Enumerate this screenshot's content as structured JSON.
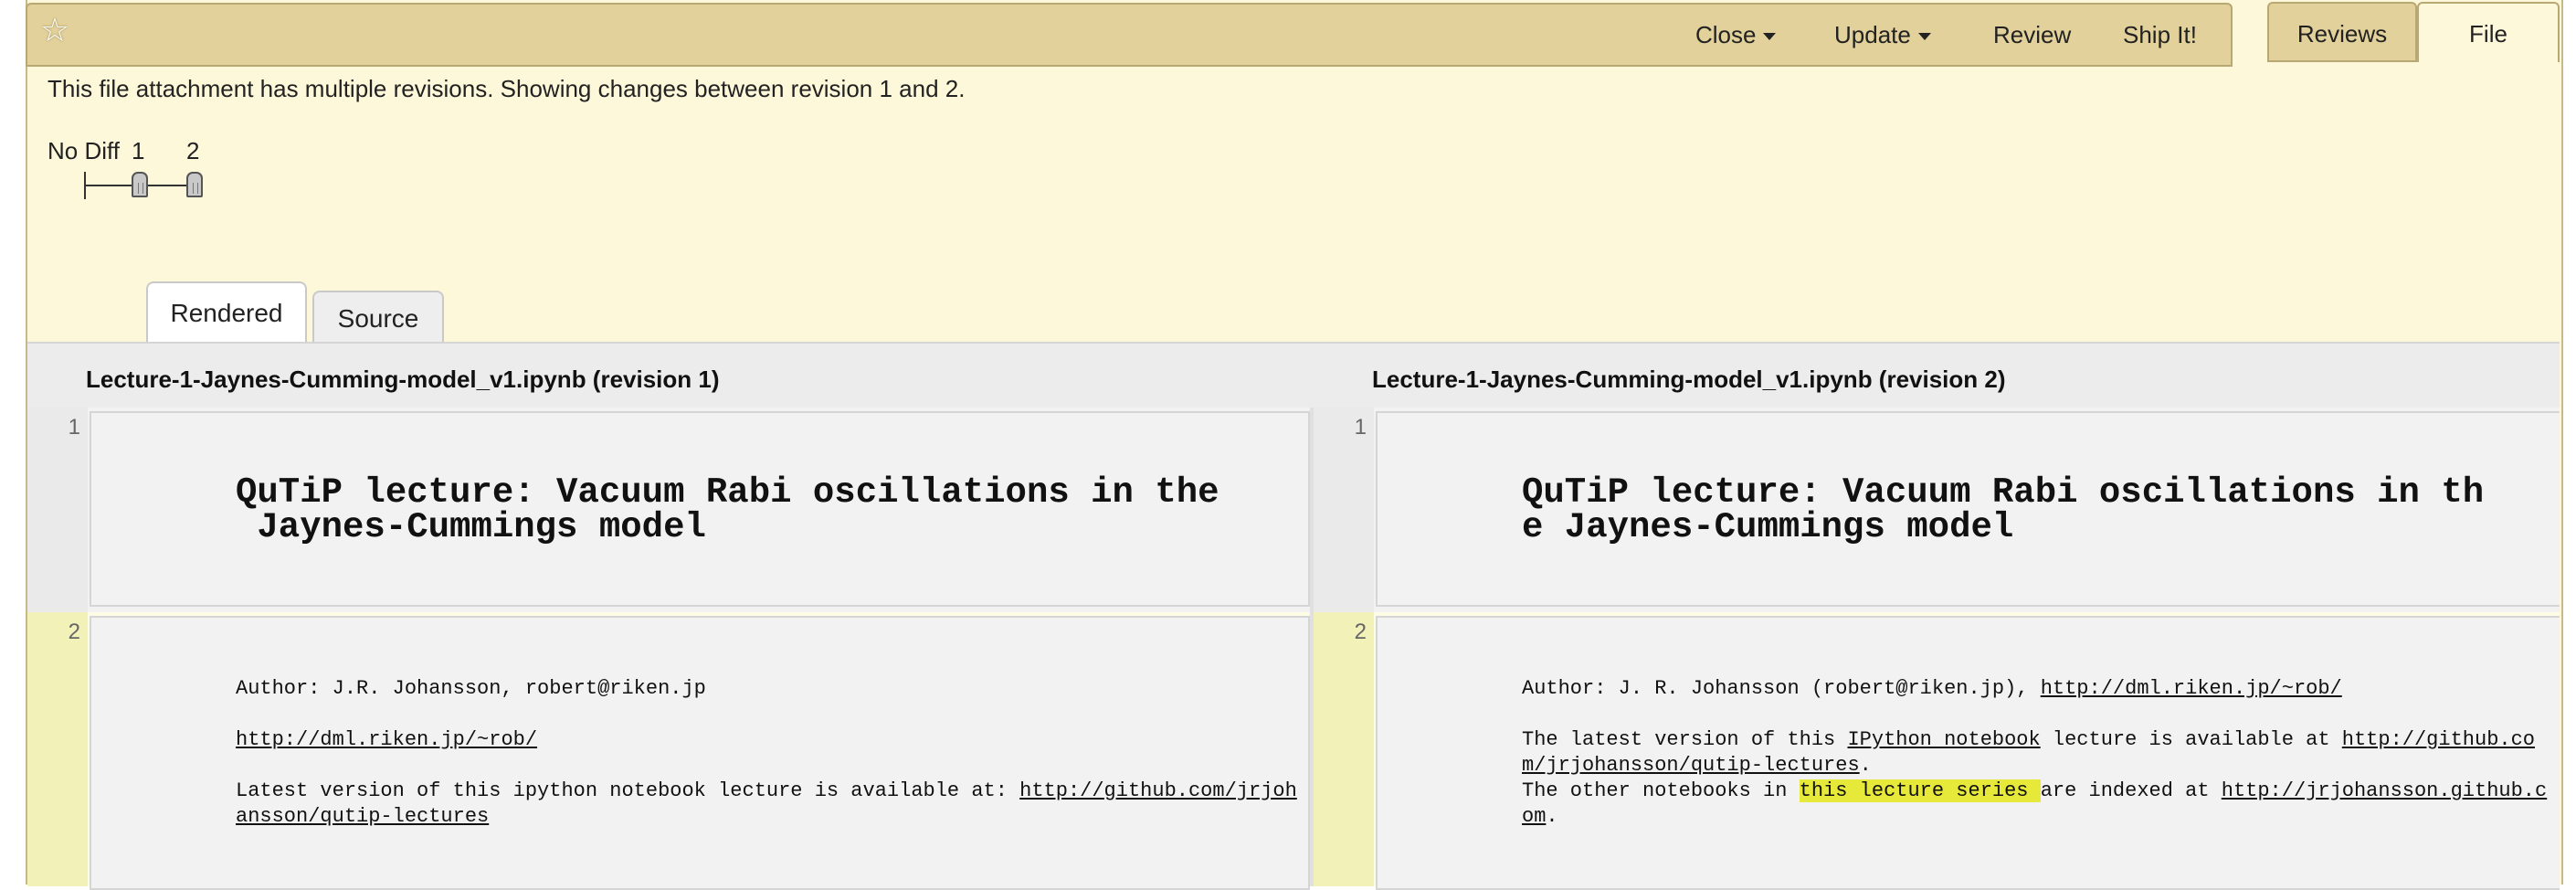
{
  "toolbar": {
    "menu": [
      {
        "label": "Close",
        "has_caret": true
      },
      {
        "label": "Update",
        "has_caret": true
      },
      {
        "label": "Review",
        "has_caret": false
      },
      {
        "label": "Ship It!",
        "has_caret": false
      }
    ],
    "tabs": {
      "reviews": "Reviews",
      "file": "File"
    }
  },
  "notice": "This file attachment has multiple revisions. Showing changes between revision 1 and 2.",
  "revision_selector": {
    "no_diff": "No Diff",
    "rev1": "1",
    "rev2": "2"
  },
  "view_tabs": {
    "rendered": "Rendered",
    "source": "Source"
  },
  "diff": {
    "left_file": "Lecture-1-Jaynes-Cumming-model_v1.ipynb (revision 1)",
    "right_file": "Lecture-1-Jaynes-Cumming-model_v1.ipynb (revision 2)",
    "rows": [
      {
        "line_left": "1",
        "line_right": "1",
        "left_title_l1": "QuTiP lecture: Vacuum Rabi oscillations in the",
        "left_title_l2": " Jaynes-Cummings model",
        "right_title_l1": "QuTiP lecture: Vacuum Rabi oscillations in th",
        "right_title_l2": "e Jaynes-Cummings model"
      },
      {
        "line_left": "2",
        "line_right": "2",
        "left": {
          "author": "Author: J.R. Johansson, robert@riken.jp",
          "url": "http://dml.riken.jp/~rob/",
          "latest_prefix": "Latest version of this ipython notebook lecture is available at: ",
          "latest_link_l1": "http://github.com/jrjoh",
          "latest_link_l2": "ansson/qutip-lectures"
        },
        "right": {
          "author_prefix": "Author: J. R. Johansson (robert@riken.jp), ",
          "author_link": "http://dml.riken.jp/~rob/",
          "latest_prefix": "The latest version of this ",
          "ipython_link": "IPython notebook",
          "latest_mid": " lecture is available at ",
          "github_link_l1": "http://github.co",
          "github_link_l2": "m/jrjohansson/qutip-lectures",
          "period1": ".",
          "other_prefix": "The other notebooks in ",
          "other_highlight": "this lecture series ",
          "other_mid": "are indexed at ",
          "index_link_l1": "http://jrjohansson.github.c",
          "index_link_l2": "om",
          "period2": "."
        }
      }
    ]
  },
  "colors": {
    "toolbar_bg": "#e2d19a",
    "page_bg": "#fef8da",
    "changed_gutter": "#f2f2b8",
    "highlight": "#e6e83a"
  }
}
